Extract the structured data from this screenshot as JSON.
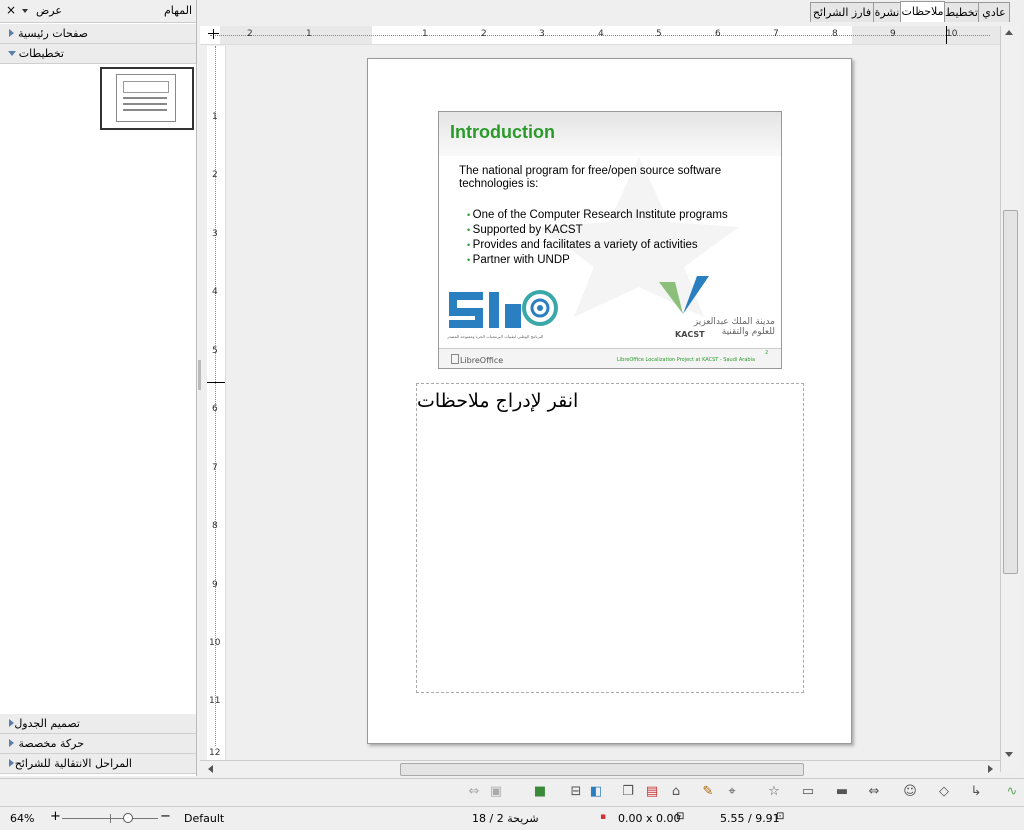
{
  "task_pane": {
    "title": "المهام",
    "view_menu": "عرض",
    "close": "×",
    "sections_top": [
      {
        "label": "صفحات رئيسية"
      },
      {
        "label": "تخطيطات"
      }
    ],
    "sections_bottom": [
      {
        "label": "تصميم الجدول"
      },
      {
        "label": "حركة مخصصة"
      },
      {
        "label": "المراحل الانتقالية للشرائح"
      }
    ]
  },
  "view_tabs": [
    "عادي",
    "تخطيط",
    "ملاحظات",
    "نشرة",
    "فارز الشرائح"
  ],
  "ruler": {
    "h_ticks": [
      "2",
      "1",
      "1",
      "2",
      "3",
      "4",
      "5",
      "6",
      "7",
      "8",
      "9",
      "10"
    ],
    "v_ticks": [
      "1",
      "2",
      "3",
      "4",
      "5",
      "6",
      "7",
      "8",
      "9",
      "10",
      "11",
      "12"
    ]
  },
  "slide": {
    "title": "Introduction",
    "intro": "The national program for free/open source software technologies is:",
    "bullets": [
      "One of the Computer Research Institute programs",
      "Supported by KACST",
      "Provides and facilitates a variety of activities",
      "Partner with UNDP"
    ],
    "logo_left_caption": "البرنامج الوطني لتقنيات البرمجيات الحرة ومفتوحة المصدر",
    "logo_right_line1": "مدينة الملك عبدالعزيز",
    "logo_right_line2": "للعلوم والتقنية",
    "logo_right_abbr": "KACST",
    "footer_left": "LibreOffice",
    "footer_right": "LibreOffice Localization Project at KACST - Saudi Arabia",
    "footer_page": "2"
  },
  "notes_placeholder": "انقر لإدراج ملاحظات",
  "status": {
    "zoom": "64%",
    "master": "Default",
    "slide_counter": "شريحة 2 / 18",
    "size": "0.00 x 0.00",
    "position": "5.55 / 9.91"
  },
  "colors": {
    "slide_title": "#2a9a2a",
    "bullet": "#2a9a2a",
    "logo_blue": "#2a7fc0",
    "logo_teal": "#3aa8a8"
  }
}
